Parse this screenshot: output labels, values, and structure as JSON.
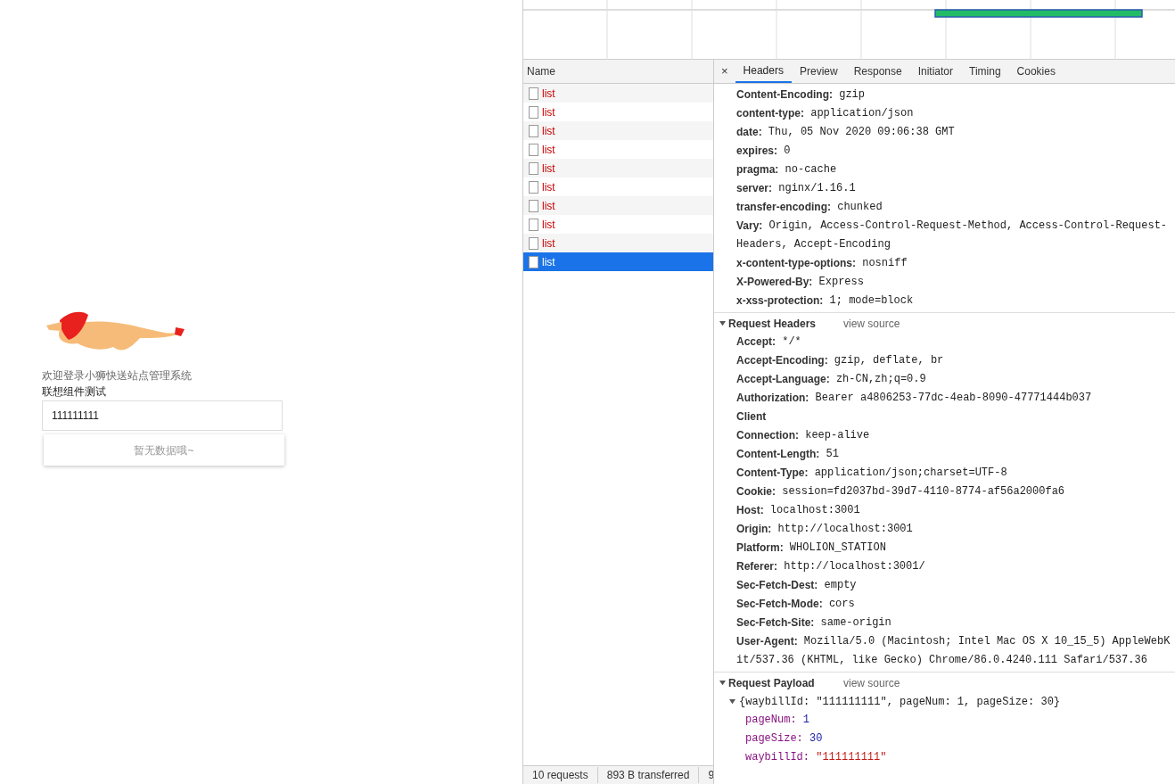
{
  "app": {
    "welcome": "欢迎登录小狮快送站点管理系统",
    "label": "联想组件测试",
    "input_value": "111111111",
    "empty_text": "暂无数据哦~"
  },
  "network": {
    "column": "Name",
    "requests": [
      {
        "name": "list",
        "selected": false
      },
      {
        "name": "list",
        "selected": false
      },
      {
        "name": "list",
        "selected": false
      },
      {
        "name": "list",
        "selected": false
      },
      {
        "name": "list",
        "selected": false
      },
      {
        "name": "list",
        "selected": false
      },
      {
        "name": "list",
        "selected": false
      },
      {
        "name": "list",
        "selected": false
      },
      {
        "name": "list",
        "selected": false
      },
      {
        "name": "list",
        "selected": true
      }
    ],
    "status_bar": [
      "10 requests",
      "893 B transferred",
      "9"
    ]
  },
  "details": {
    "close": "×",
    "tabs": [
      {
        "label": "Headers",
        "selected": true
      },
      {
        "label": "Preview",
        "selected": false
      },
      {
        "label": "Response",
        "selected": false
      },
      {
        "label": "Initiator",
        "selected": false
      },
      {
        "label": "Timing",
        "selected": false
      },
      {
        "label": "Cookies",
        "selected": false
      }
    ],
    "response_headers": [
      {
        "name": "Content-Encoding:",
        "value": "gzip"
      },
      {
        "name": "content-type:",
        "value": "application/json"
      },
      {
        "name": "date:",
        "value": "Thu, 05 Nov 2020 09:06:38 GMT"
      },
      {
        "name": "expires:",
        "value": "0"
      },
      {
        "name": "pragma:",
        "value": "no-cache"
      },
      {
        "name": "server:",
        "value": "nginx/1.16.1"
      },
      {
        "name": "transfer-encoding:",
        "value": "chunked"
      },
      {
        "name": "Vary:",
        "value": "Origin, Access-Control-Request-Method, Access-Control-Request-Headers, Accept-Encoding"
      },
      {
        "name": "x-content-type-options:",
        "value": "nosniff"
      },
      {
        "name": "X-Powered-By:",
        "value": "Express"
      },
      {
        "name": "x-xss-protection:",
        "value": "1; mode=block"
      }
    ],
    "request_headers": {
      "title": "Request Headers",
      "expanded": true,
      "link": "view source",
      "rows": [
        {
          "name": "Accept:",
          "value": "*/*"
        },
        {
          "name": "Accept-Encoding:",
          "value": "gzip, deflate, br"
        },
        {
          "name": "Accept-Language:",
          "value": "zh-CN,zh;q=0.9"
        },
        {
          "name": "Authorization:",
          "value": "Bearer a4806253-77dc-4eab-8090-47771444b037"
        },
        {
          "name": "Client",
          "value": ""
        },
        {
          "name": "Connection:",
          "value": "keep-alive"
        },
        {
          "name": "Content-Length:",
          "value": "51"
        },
        {
          "name": "Content-Type:",
          "value": "application/json;charset=UTF-8"
        },
        {
          "name": "Cookie:",
          "value": "session=fd2037bd-39d7-4110-8774-af56a2000fa6"
        },
        {
          "name": "Host:",
          "value": "localhost:3001"
        },
        {
          "name": "Origin:",
          "value": "http://localhost:3001"
        },
        {
          "name": "Platform:",
          "value": "WHOLION_STATION"
        },
        {
          "name": "Referer:",
          "value": "http://localhost:3001/"
        },
        {
          "name": "Sec-Fetch-Dest:",
          "value": "empty"
        },
        {
          "name": "Sec-Fetch-Mode:",
          "value": "cors"
        },
        {
          "name": "Sec-Fetch-Site:",
          "value": "same-origin"
        },
        {
          "name": "User-Agent:",
          "value": "Mozilla/5.0 (Macintosh; Intel Mac OS X 10_15_5) AppleWebKit/537.36 (KHTML, like Gecko) Chrome/86.0.4240.111 Safari/537.36"
        }
      ]
    },
    "payload": {
      "title": "Request Payload",
      "expanded": true,
      "link": "view source",
      "summary": "{waybillId: \"111111111\", pageNum: 1, pageSize: 30}",
      "summary_expanded": true,
      "fields": [
        {
          "key": "pageNum:",
          "value": "1",
          "kind": "number"
        },
        {
          "key": "pageSize:",
          "value": "30",
          "kind": "number"
        },
        {
          "key": "waybillId:",
          "value": "\"111111111\"",
          "kind": "string"
        }
      ]
    }
  }
}
